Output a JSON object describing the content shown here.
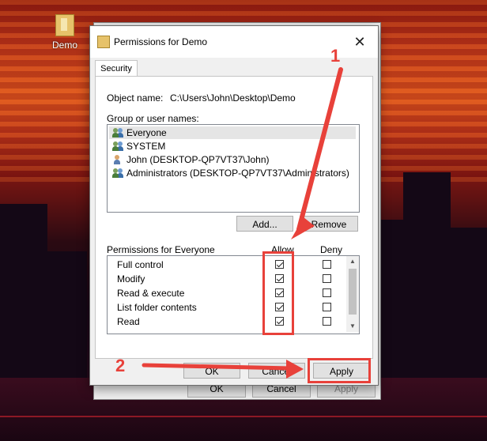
{
  "desktop": {
    "icon_label": "Demo"
  },
  "back_dialog": {
    "ok_label": "OK",
    "cancel_label": "Cancel",
    "apply_label": "Apply"
  },
  "dialog": {
    "title": "Permissions for Demo",
    "tab_security": "Security",
    "object_name_label": "Object name:",
    "object_name_value": "C:\\Users\\John\\Desktop\\Demo",
    "group_label": "Group or user names:",
    "users": [
      {
        "name": "Everyone",
        "selected": true
      },
      {
        "name": "SYSTEM",
        "selected": false
      },
      {
        "name": "John (DESKTOP-QP7VT37\\John)",
        "selected": false
      },
      {
        "name": "Administrators (DESKTOP-QP7VT37\\Administrators)",
        "selected": false
      }
    ],
    "add_label": "Add...",
    "remove_label": "Remove",
    "permissions_label": "Permissions for Everyone",
    "allow_label": "Allow",
    "deny_label": "Deny",
    "permissions": [
      {
        "name": "Full control",
        "allow": true,
        "deny": false
      },
      {
        "name": "Modify",
        "allow": true,
        "deny": false
      },
      {
        "name": "Read & execute",
        "allow": true,
        "deny": false
      },
      {
        "name": "List folder contents",
        "allow": true,
        "deny": false
      },
      {
        "name": "Read",
        "allow": true,
        "deny": false
      }
    ],
    "ok_label": "OK",
    "cancel_label": "Cancel",
    "apply_label": "Apply"
  },
  "annotations": {
    "step1": "1",
    "step2": "2",
    "color": "#e8413a"
  }
}
